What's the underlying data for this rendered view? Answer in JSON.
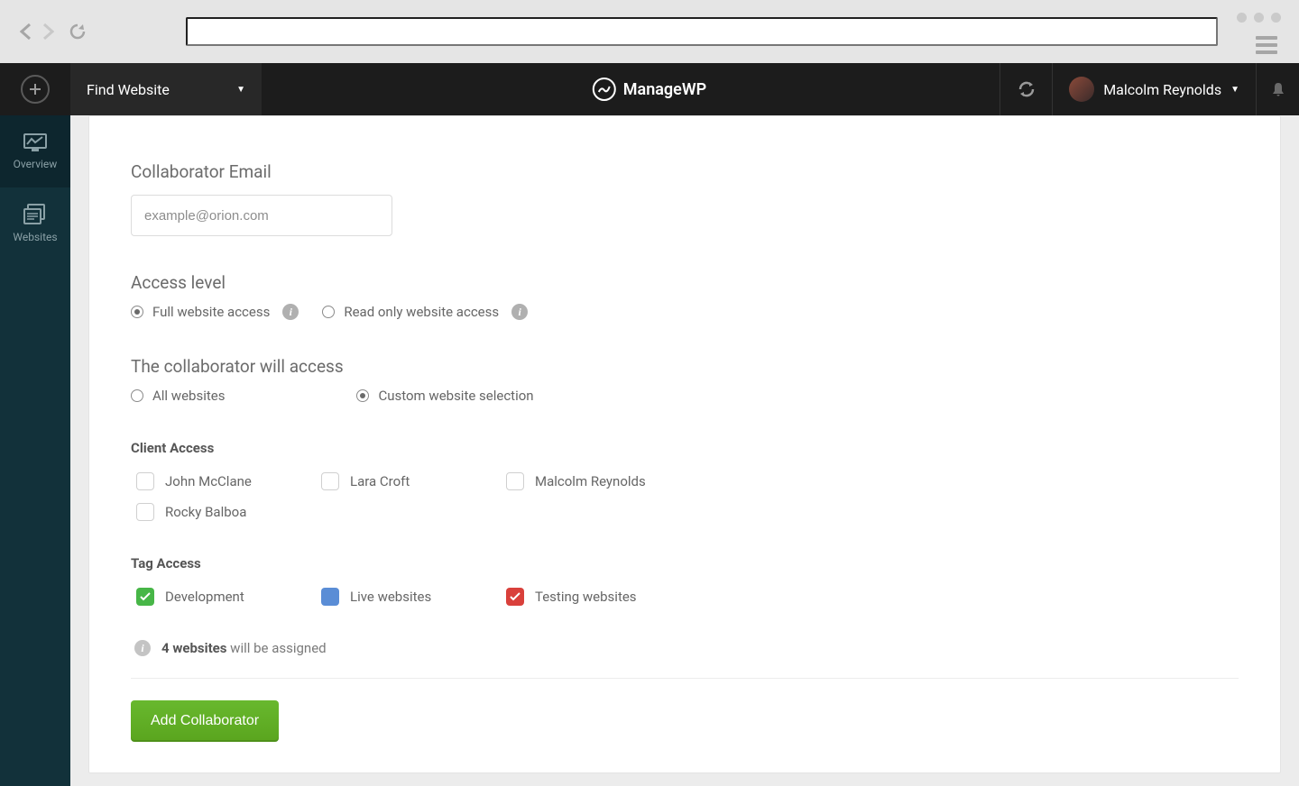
{
  "browser": {
    "address": ""
  },
  "header": {
    "find_label": "Find Website",
    "brand": "ManageWP",
    "user_name": "Malcolm Reynolds"
  },
  "sidebar": {
    "overview": "Overview",
    "websites": "Websites"
  },
  "form": {
    "email_label": "Collaborator Email",
    "email_placeholder": "example@orion.com",
    "email_value": "",
    "access_level_label": "Access level",
    "access_level_options": {
      "full": "Full website access",
      "read_only": "Read only website access"
    },
    "scope_label": "The collaborator will access",
    "scope_options": {
      "all": "All websites",
      "custom": "Custom website selection"
    },
    "client_access_heading": "Client Access",
    "clients": [
      "John McClane",
      "Lara Croft",
      "Malcolm Reynolds",
      "Rocky Balboa"
    ],
    "tag_access_heading": "Tag Access",
    "tags": [
      {
        "label": "Development",
        "checked": true,
        "color": "green"
      },
      {
        "label": "Live websites",
        "checked": false,
        "color": "blue-solid"
      },
      {
        "label": "Testing websites",
        "checked": true,
        "color": "red"
      }
    ],
    "assigned_count": "4 websites",
    "assigned_suffix": " will be assigned",
    "submit_label": "Add Collaborator"
  }
}
